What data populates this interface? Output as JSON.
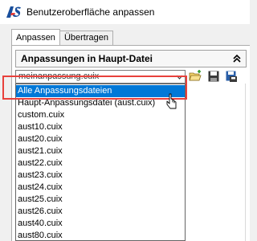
{
  "window": {
    "title": "Benutzeroberfläche anpassen",
    "logo_text": "AS"
  },
  "tabs": [
    {
      "label": "Anpassen",
      "active": true
    },
    {
      "label": "Übertragen",
      "active": false
    }
  ],
  "section": {
    "title": "Anpassungen in Haupt-Datei",
    "collapse_icon": "double-chevron-up-icon"
  },
  "combo": {
    "value": "meinanpassung.cuix",
    "arrow_icon": "chevron-down-icon"
  },
  "toolbar": {
    "icons": [
      "open-file-icon",
      "save-icon",
      "save-as-icon"
    ]
  },
  "dropdown": {
    "items": [
      {
        "label": "Alle Anpassungsdateien",
        "selected": true
      },
      {
        "label": "Haupt-Anpassungsdatei (aust.cuix)",
        "selected": false
      },
      {
        "label": "custom.cuix",
        "selected": false
      },
      {
        "label": "aust10.cuix",
        "selected": false
      },
      {
        "label": "aust20.cuix",
        "selected": false
      },
      {
        "label": "aust21.cuix",
        "selected": false
      },
      {
        "label": "aust22.cuix",
        "selected": false
      },
      {
        "label": "aust23.cuix",
        "selected": false
      },
      {
        "label": "aust24.cuix",
        "selected": false
      },
      {
        "label": "aust25.cuix",
        "selected": false
      },
      {
        "label": "aust26.cuix",
        "selected": false
      },
      {
        "label": "aust40.cuix",
        "selected": false
      },
      {
        "label": "aust80.cuix",
        "selected": false
      }
    ]
  },
  "colors": {
    "selection": "#0078d7",
    "highlight_box": "#e8413c",
    "logo_primary": "#1a4f9c",
    "logo_accent": "#e8413c"
  }
}
